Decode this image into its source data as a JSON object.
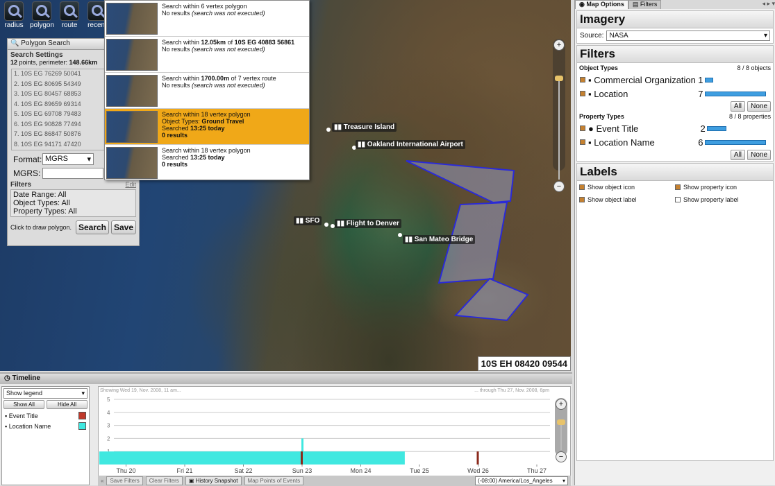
{
  "map": {
    "tools": [
      {
        "label": "radius",
        "icon": "radius-search-icon"
      },
      {
        "label": "polygon",
        "icon": "polygon-search-icon"
      },
      {
        "label": "route",
        "icon": "route-search-icon"
      },
      {
        "label": "recent",
        "icon": "recent-searches-icon"
      }
    ],
    "coordinate_readout": "10S EH 08420 09544",
    "places": [
      {
        "name": "Treasure Island"
      },
      {
        "name": "Oakland International Airport"
      },
      {
        "name": "SFO"
      },
      {
        "name": "Flight to Denver"
      },
      {
        "name": "San Mateo Bridge"
      }
    ]
  },
  "polygon_search": {
    "title": "Polygon Search",
    "settings_title": "Search Settings",
    "points_line_a": "12",
    "points_line_b": " points, perimeter: ",
    "perimeter": "148.66km",
    "points": [
      "1. 10S EG 76269 50041",
      "2. 10S EG 80695 54349",
      "3. 10S EG 80457 68853",
      "4. 10S EG 89659 69314",
      "5. 10S EG 69708 79483",
      "6. 10S EG 90828 77494",
      "7. 10S EG 86847 50876",
      "8. 10S EG 94171 47420"
    ],
    "format_label": "Format:",
    "format_value": "MGRS",
    "mgrs_label": "MGRS:",
    "filters_label": "Filters",
    "edit_link": "Edit",
    "filters": [
      "Date Range: All",
      "Object Types: All",
      "Property Types: All"
    ],
    "hint": "Click to draw polygon.",
    "search_button": "Search",
    "save_button": "Save"
  },
  "recent_searches": [
    {
      "line1": "Search within 6 vertex polygon",
      "line2a": "No results ",
      "line2b": "(search was not executed)"
    },
    {
      "line1a": "Search within ",
      "line1b": "12.05km",
      "line1c": " of ",
      "line1d": "10S EG 40883 56861",
      "line2a": "No results ",
      "line2b": "(search was not executed)"
    },
    {
      "line1a": "Search within ",
      "line1b": "1700.00m",
      "line1c": " of 7 vertex route",
      "line2a": "No results ",
      "line2b": "(search was not executed)"
    },
    {
      "line1": "Search within 18 vertex polygon",
      "types_a": "Object Types: ",
      "types_b": "Ground Travel",
      "searched_a": "Searched ",
      "searched_b": "13:25 today",
      "results": "0 results"
    },
    {
      "line1": "Search within 18 vertex polygon",
      "searched_a": "Searched ",
      "searched_b": "13:25 today",
      "results": "0 results"
    }
  ],
  "right_panel": {
    "tabs": [
      "Map Options",
      "Filters"
    ],
    "imagery_title": "Imagery",
    "source_label": "Source:",
    "source_value": "NASA",
    "filters_title": "Filters",
    "object_types_label": "Object Types",
    "object_types_count": "8 / 8 objects",
    "object_types": [
      {
        "name": "Commercial Organization",
        "count": "1",
        "fraction": 0.14
      },
      {
        "name": "Location",
        "count": "7",
        "fraction": 1.0
      }
    ],
    "property_types_label": "Property Types",
    "property_types_count": "8 / 8 properties",
    "property_types": [
      {
        "name": "Event Title",
        "count": "2",
        "fraction": 0.33
      },
      {
        "name": "Location Name",
        "count": "6",
        "fraction": 1.0
      }
    ],
    "all_btn": "All",
    "none_btn": "None",
    "labels_title": "Labels",
    "labels": [
      {
        "text": "Show object icon",
        "checked": true
      },
      {
        "text": "Show property icon",
        "checked": true
      },
      {
        "text": "Show object label",
        "checked": true
      },
      {
        "text": "Show property label",
        "checked": false
      }
    ]
  },
  "timeline": {
    "title": "Timeline",
    "legend_select": "Show legend",
    "show_all": "Show All",
    "hide_all": "Hide All",
    "legend": [
      {
        "name": "Event Title",
        "color": "#c0392b"
      },
      {
        "name": "Location Name",
        "color": "#40e8e0"
      }
    ],
    "range_start": "Showing Wed 19, Nov. 2008, 11 am...",
    "range_end": "... through Thu 27, Nov. 2008, 6pm",
    "bottom_buttons": [
      "Save Filters",
      "Clear Filters",
      "History Snapshot",
      "Map Points of Events"
    ],
    "timezone": "(-08:00) America/Los_Angeles"
  },
  "chart_data": {
    "type": "bar",
    "x_ticks": [
      "Thu 20",
      "Fri 21",
      "Sat 22",
      "Sun 23",
      "Mon 24",
      "Tue 25",
      "Wed 26",
      "Thu 27"
    ],
    "y_ticks": [
      "1",
      "2",
      "3",
      "4",
      "5"
    ],
    "ylim": [
      0,
      5
    ],
    "series": [
      {
        "name": "Location Name",
        "segments": [
          {
            "from": "Wed 19",
            "to": "Mon 24 18:00",
            "value": 1
          },
          {
            "from": "Sun 23 00:00",
            "to": "Sun 23 00:30",
            "value": 2
          }
        ]
      },
      {
        "name": "Event Title",
        "segments": [
          {
            "at": "Sun 23",
            "value": 1
          },
          {
            "at": "Wed 26",
            "value": 1
          }
        ]
      }
    ]
  }
}
